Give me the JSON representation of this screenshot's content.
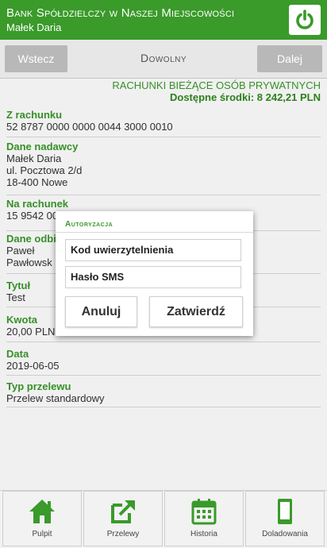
{
  "header": {
    "bank_name": "Bank Spółdzielczy w Naszej Miejscowości",
    "user_name": "Małek Daria"
  },
  "toolbar": {
    "back_label": "Wstecz",
    "title": "Dowolny",
    "next_label": "Dalej"
  },
  "account": {
    "type": "RACHUNKI BIEŻĄCE OSÓB PRYWATNYCH",
    "available": "Dostępne środki: 8 242,21 PLN"
  },
  "fields": {
    "from_account": {
      "label": "Z rachunku",
      "value": "52 8787 0000 0000 0044 3000 0010"
    },
    "sender": {
      "label": "Dane nadawcy",
      "line1": "Małek Daria",
      "line2": "ul. Pocztowa 2/d",
      "line3": "18-400 Nowe"
    },
    "to_account": {
      "label": "Na rachunek",
      "value": "15 9542 00"
    },
    "recipient": {
      "label": "Dane odbi",
      "line1": "Paweł",
      "line2": "Pawłowsk"
    },
    "title": {
      "label": "Tytuł",
      "value": "Test"
    },
    "amount": {
      "label": "Kwota",
      "value": "20,00 PLN"
    },
    "date": {
      "label": "Data",
      "value": "2019-06-05"
    },
    "transfer_type": {
      "label": "Typ przelewu",
      "value": "Przelew standardowy"
    }
  },
  "dialog": {
    "title": "Autoryzacja",
    "code_placeholder": "Kod uwierzytelnienia",
    "sms_placeholder": "Hasło SMS",
    "cancel_label": "Anuluj",
    "confirm_label": "Zatwierdź"
  },
  "nav": [
    {
      "label": "Pulpit",
      "icon": "home-icon"
    },
    {
      "label": "Przelewy",
      "icon": "transfer-icon"
    },
    {
      "label": "Historia",
      "icon": "calendar-icon"
    },
    {
      "label": "Doladowania",
      "icon": "phone-icon"
    }
  ],
  "colors": {
    "brand_green": "#3a9a2a",
    "button_gray": "#b8b8b8"
  }
}
